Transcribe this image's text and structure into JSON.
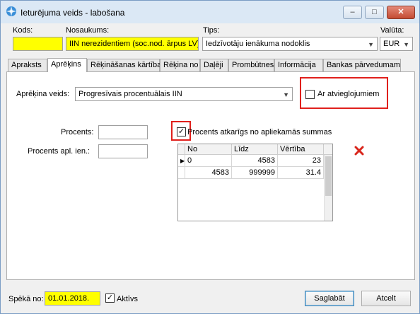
{
  "window": {
    "title": "Ieturējuma veids - labošana",
    "controls": [
      "–",
      "□",
      "✕"
    ]
  },
  "header": {
    "kods_label": "Kods:",
    "kods_value": "",
    "nosaukums_label": "Nosaukums:",
    "nosaukums_value": "IIN nerezidentiem (soc.nod. ārpus LV)",
    "tips_label": "Tips:",
    "tips_value": "Iedzīvotāju ienākuma nodoklis",
    "valuta_label": "Valūta:",
    "valuta_value": "EUR"
  },
  "tabs": [
    "Apraksts",
    "Aprēķins",
    "Rēķināšanas kārtība",
    "Rēķina no",
    "Daļēji",
    "Prombūtnes",
    "Informācija",
    "Bankas pārvedumam"
  ],
  "active_tab": "Aprēķins",
  "aprekins": {
    "veids_label": "Aprēķina veids:",
    "veids_value": "Progresīvais procentuālais IIN",
    "atvieglojumi_label": "Ar atvieglojumiem",
    "atvieglojumi_checked": false,
    "procents_label": "Procents:",
    "procents_value": "",
    "procents_apl_label": "Procents apl. ien.:",
    "procents_apl_value": "",
    "atkarigs_label": "Procents atkarīgs no apliekamās summas",
    "atkarigs_checked": true,
    "delete_icon": "red-x-icon"
  },
  "grid": {
    "columns": [
      "No",
      "Līdz",
      "Vērtība"
    ],
    "rows": [
      [
        "0",
        "4583",
        "23"
      ],
      [
        "4583",
        "999999",
        "31.4"
      ]
    ]
  },
  "footer": {
    "speka_label": "Spēkā no:",
    "speka_value": "01.01.2018.",
    "aktivs_label": "Aktīvs",
    "aktivs_checked": true,
    "save_label": "Saglabāt",
    "cancel_label": "Atcelt"
  },
  "colors": {
    "highlight": "#ffff00",
    "annotation": "#e0201c",
    "title_bar": "#dbe8f5"
  }
}
